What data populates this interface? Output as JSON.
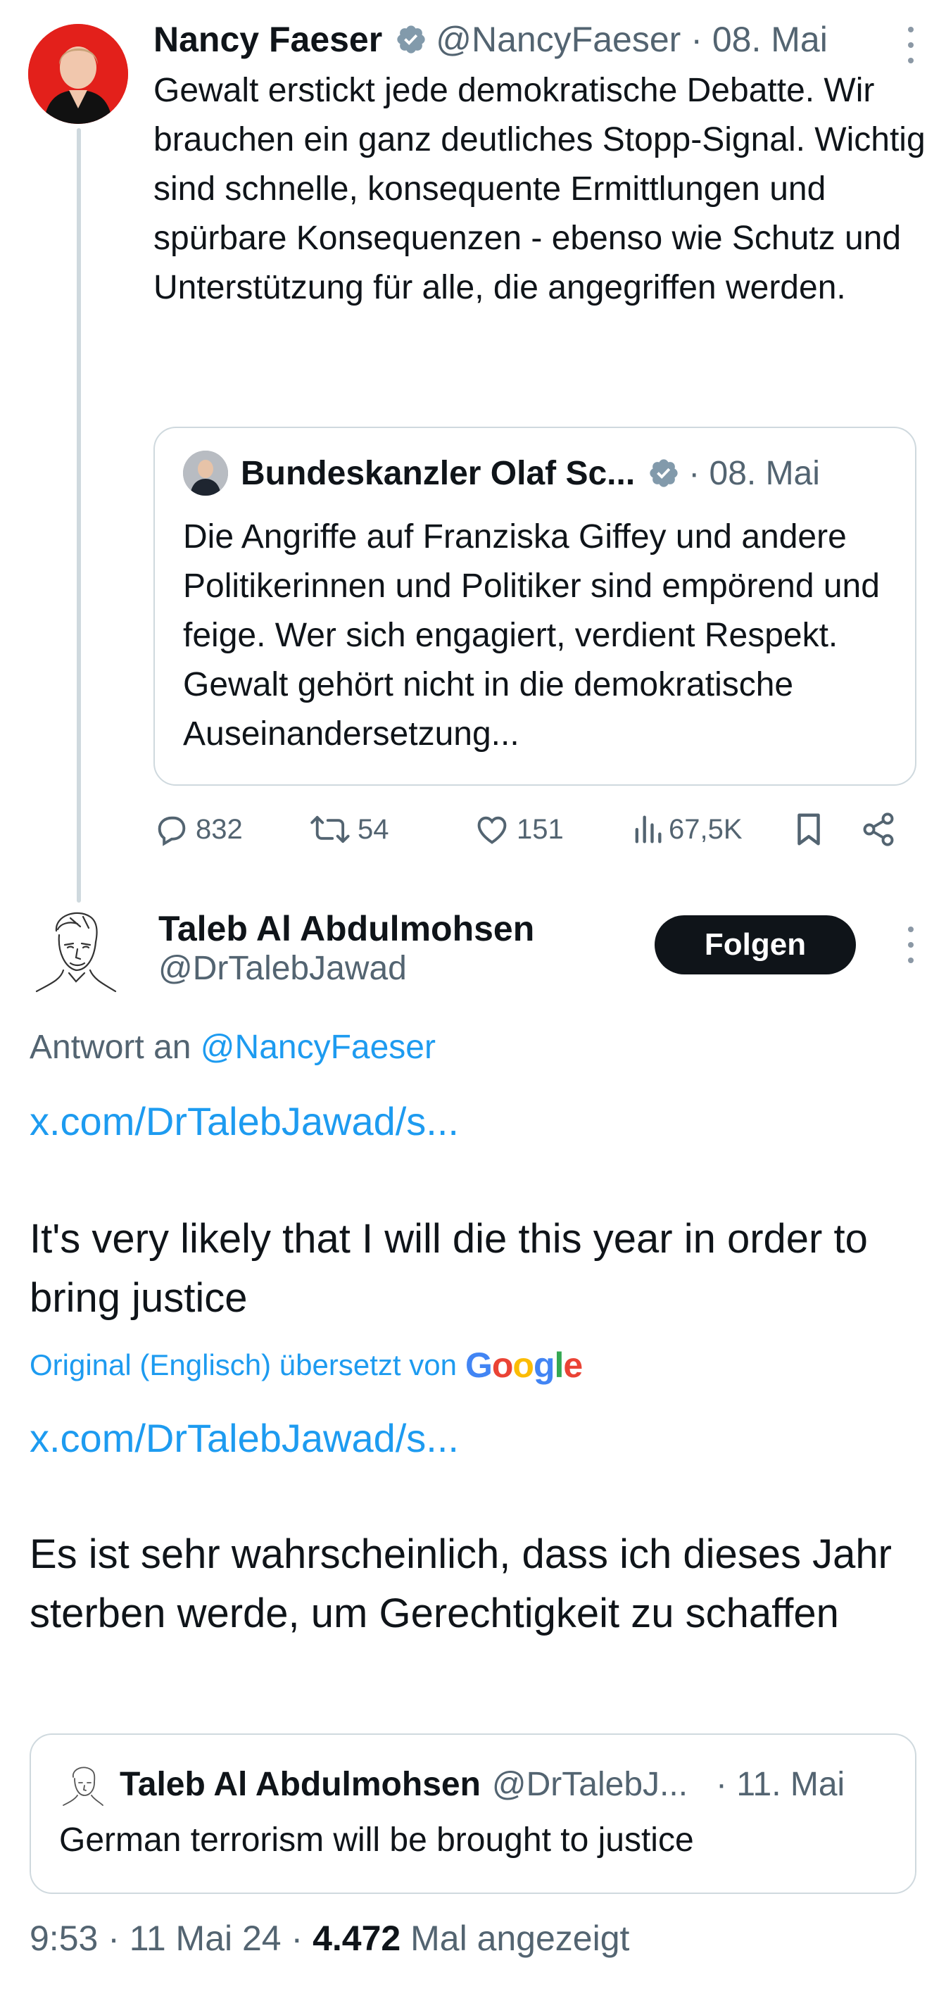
{
  "parent_tweet": {
    "name": "Nancy Faeser",
    "handle": "@NancyFaeser",
    "date": "· 08. Mai",
    "text": "Gewalt erstickt jede demokratische Debatte. Wir brauchen ein ganz deutliches Stopp-Signal. Wichtig sind schnelle, konsequente Ermittlungen und spürbare Konsequenzen - ebenso wie Schutz und Unterstützung für alle, die angegriffen werden.",
    "quote": {
      "name": "Bundeskanzler Olaf Sc...",
      "date": "· 08. Mai",
      "text": "Die Angriffe auf Franziska Giffey und andere Politikerinnen und Politiker sind empörend und feige. Wer sich engagiert, verdient Respekt. Gewalt gehört nicht in die demokratische Auseinandersetzung..."
    },
    "actions": {
      "replies": "832",
      "reposts": "54",
      "likes": "151",
      "views": "67,5K"
    }
  },
  "reply_tweet": {
    "name": "Taleb Al Abdulmohsen",
    "handle": "@DrTalebJawad",
    "follow_label": "Folgen",
    "reply_prefix": "Antwort an",
    "reply_handle": "@NancyFaeser",
    "link1": "x.com/DrTalebJawad/s...",
    "original_text": "It's very likely that I will die this year in order to bring justice",
    "translated_label": "Original (Englisch) übersetzt von",
    "link2": "x.com/DrTalebJawad/s...",
    "translated_text": "Es ist sehr wahrscheinlich, dass ich dieses Jahr sterben werde, um Gerechtigkeit zu schaffen",
    "quote": {
      "name": "Taleb Al Abdulmohsen",
      "handle": "@DrTalebJ...",
      "date": "· 11. Mai",
      "text": "German terrorism will be brought to justice"
    },
    "meta": {
      "time_date": "9:53 · 11 Mai 24 ·",
      "views_count": "4.472",
      "views_label": "Mal angezeigt"
    }
  },
  "colors": {
    "link": "#1d9bf0",
    "muted": "#536471",
    "border": "#cfd9de",
    "text": "#0f1419",
    "verified": "#829aab"
  },
  "icons": [
    "verified-badge-icon",
    "reply-icon",
    "repost-icon",
    "like-icon",
    "views-icon",
    "bookmark-icon",
    "share-icon",
    "more-icon",
    "google-logo"
  ]
}
